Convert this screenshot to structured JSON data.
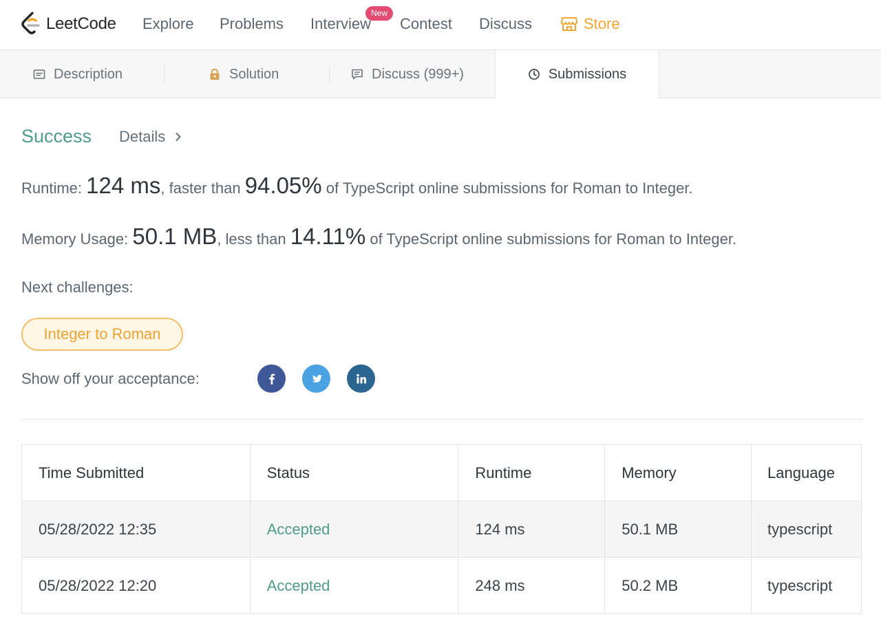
{
  "nav": {
    "logo_text": "LeetCode",
    "items": [
      "Explore",
      "Problems",
      "Interview",
      "Contest",
      "Discuss"
    ],
    "new_badge": "New",
    "store": "Store",
    "brand_color": "#f0a62f"
  },
  "tabs": {
    "description": "Description",
    "solution": "Solution",
    "discuss": "Discuss (999+)",
    "submissions": "Submissions"
  },
  "result": {
    "status": "Success",
    "details": "Details",
    "runtime_label": "Runtime:",
    "runtime_value": "124 ms",
    "runtime_mid": ", faster than",
    "runtime_percent": "94.05%",
    "runtime_tail": "of TypeScript online submissions for Roman to Integer.",
    "memory_label": "Memory Usage:",
    "memory_value": "50.1 MB",
    "memory_mid": ", less than",
    "memory_percent": "14.11%",
    "memory_tail": "of TypeScript online submissions for Roman to Integer.",
    "next_label": "Next challenges:",
    "next_challenge": "Integer to Roman",
    "share_label": "Show off your acceptance:",
    "success_color": "#4f9c87"
  },
  "table": {
    "headers": {
      "time": "Time Submitted",
      "status": "Status",
      "runtime": "Runtime",
      "memory": "Memory",
      "language": "Language"
    },
    "rows": [
      {
        "time": "05/28/2022 12:35",
        "status": "Accepted",
        "runtime": "124 ms",
        "memory": "50.1 MB",
        "language": "typescript"
      },
      {
        "time": "05/28/2022 12:20",
        "status": "Accepted",
        "runtime": "248 ms",
        "memory": "50.2 MB",
        "language": "typescript"
      }
    ]
  }
}
